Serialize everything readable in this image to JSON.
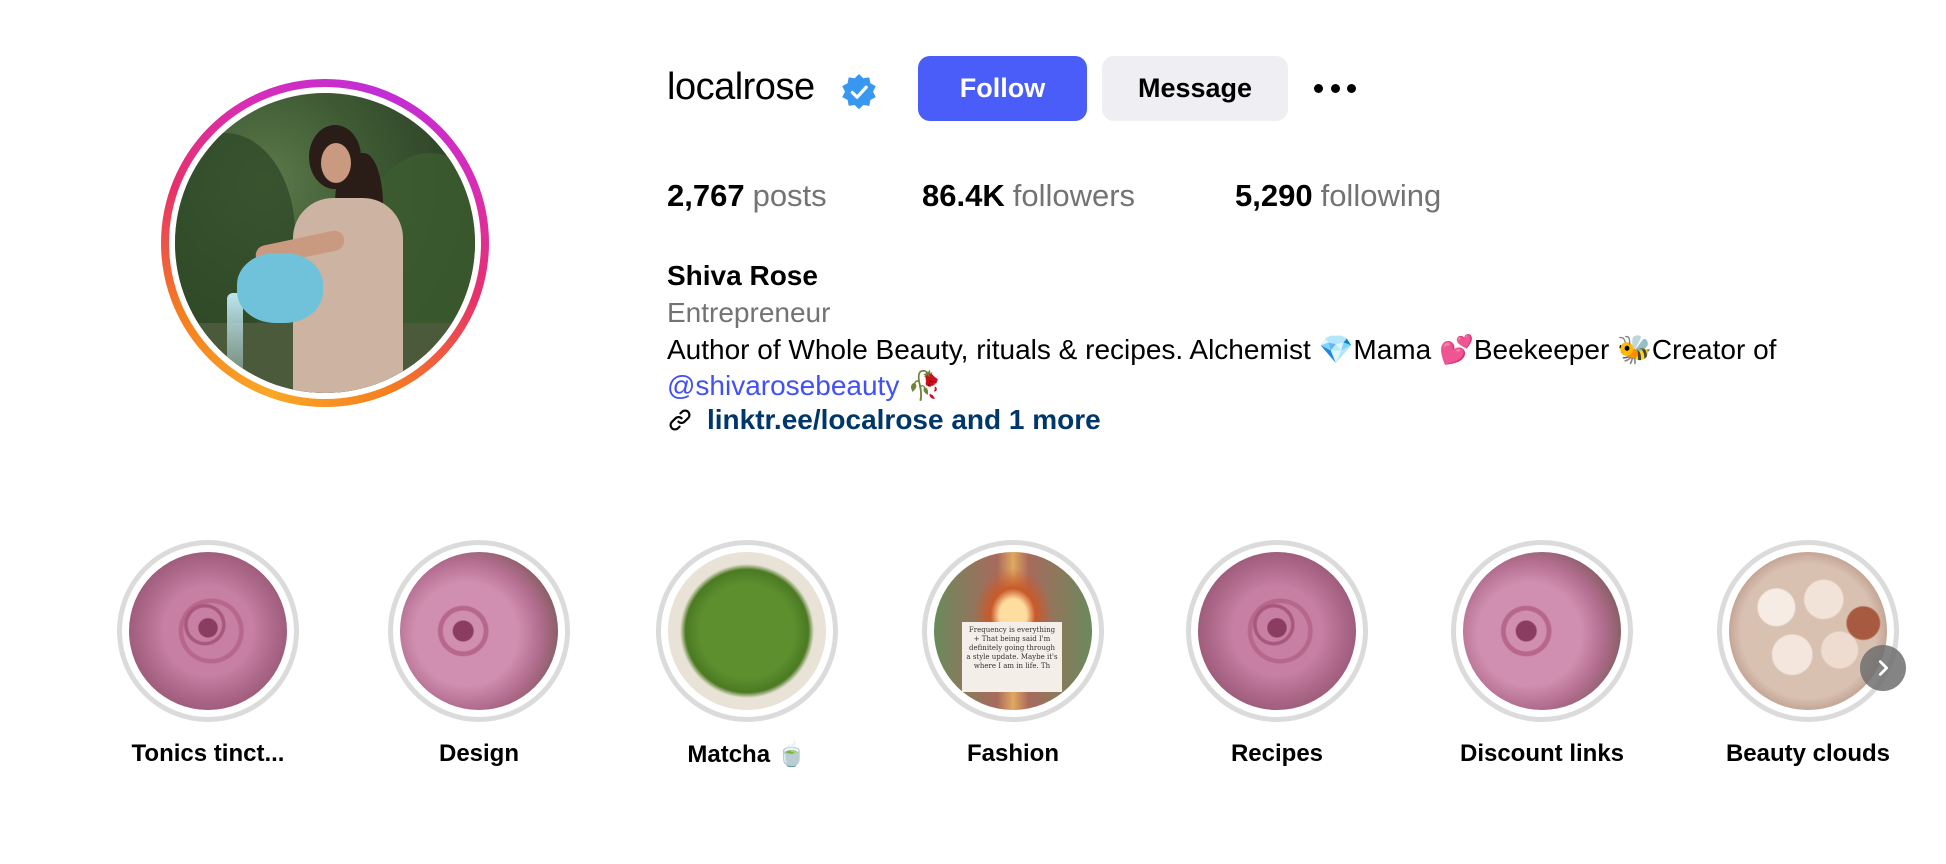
{
  "profile": {
    "username": "localrose",
    "verified": true,
    "follow_label": "Follow",
    "message_label": "Message",
    "more_icon": "more-horizontal-icon",
    "accent_color": "#4a5df9"
  },
  "stats": {
    "posts_count": "2,767",
    "posts_label": "posts",
    "followers_count": "86.4K",
    "followers_label": "followers",
    "following_count": "5,290",
    "following_label": "following"
  },
  "bio": {
    "full_name": "Shiva Rose",
    "category": "Entrepreneur",
    "text": "Author of Whole Beauty, rituals & recipes. Alchemist 💎Mama 💕Beekeeper 🐝Creator of",
    "mention": "@shivarosebeauty",
    "mention_suffix": " 🥀",
    "link": "linktr.ee/localrose and 1 more",
    "link_icon": "link-icon"
  },
  "highlights": [
    {
      "label": "Tonics tinct..."
    },
    {
      "label": "Design"
    },
    {
      "label": "Matcha 🍵"
    },
    {
      "label": "Fashion"
    },
    {
      "label": "Recipes"
    },
    {
      "label": "Discount links"
    },
    {
      "label": "Beauty clouds"
    }
  ],
  "fashion_note": "Frequency is everything + That being said I'm definitely going through a style update. Maybe it's where I am in life. Th"
}
